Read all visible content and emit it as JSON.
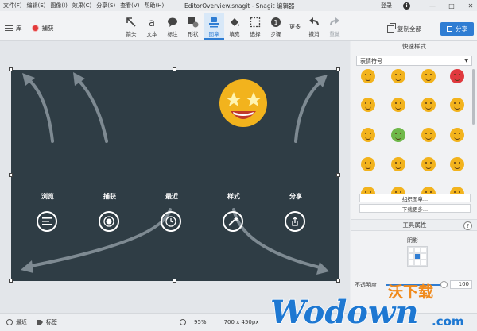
{
  "menu": [
    "文件(F)",
    "编辑(E)",
    "图像(I)",
    "效果(C)",
    "分享(S)",
    "查看(V)",
    "帮助(H)"
  ],
  "window_title": "EditorOverview.snagit - Snagit 编辑器",
  "account": {
    "login": "登录",
    "info": "i"
  },
  "window_controls": {
    "minimize": "—",
    "maximize": "□",
    "close": "✕"
  },
  "toolbar": {
    "library": "库",
    "capture": "捕获",
    "tools": [
      {
        "id": "arrow",
        "label": "箭头",
        "icon": "arrow-icon"
      },
      {
        "id": "text",
        "label": "文本",
        "icon": "text-icon"
      },
      {
        "id": "callout",
        "label": "标注",
        "icon": "callout-icon"
      },
      {
        "id": "shape",
        "label": "形状",
        "icon": "shape-icon"
      },
      {
        "id": "stamp",
        "label": "图章",
        "icon": "stamp-icon"
      },
      {
        "id": "fill",
        "label": "填充",
        "icon": "fill-icon"
      },
      {
        "id": "select",
        "label": "选择",
        "icon": "select-icon"
      },
      {
        "id": "step",
        "label": "步骤",
        "icon": "step-icon"
      }
    ],
    "more": "更多",
    "undo": "撤消",
    "redo": "重做",
    "copy_all": "复制全部",
    "share": "分享"
  },
  "canvas": {
    "features": [
      {
        "label": "浏览",
        "icon": "list-icon"
      },
      {
        "label": "捕获",
        "icon": "record-icon"
      },
      {
        "label": "最近",
        "icon": "clock-icon"
      },
      {
        "label": "样式",
        "icon": "magic-wand-icon"
      },
      {
        "label": "分享",
        "icon": "share-icon"
      }
    ]
  },
  "panel": {
    "quick_styles": "快速样式",
    "preset": "表情符号",
    "organize": "组织图章...",
    "download_more": "下载更多...",
    "tool_properties": "工具属性",
    "help": "?",
    "shadow": "阴影",
    "opacity_label": "不透明度",
    "opacity_value": "100",
    "opacity_fraction": 1.0
  },
  "status": {
    "recent": "最近",
    "tags": "标签",
    "zoom": "95%",
    "dimensions": "700 x 450px"
  },
  "watermark": {
    "text1": "沃下载",
    "text2": "Wodown",
    "text3": ".com"
  },
  "colors": {
    "accent": "#2f7dd3",
    "canvas_bg": "#2f3d45",
    "emoji_yellow": "#f2b31d",
    "capture_red": "#e23b3b",
    "watermark_orange": "#f08a1c",
    "watermark_blue": "#1e78d2"
  }
}
